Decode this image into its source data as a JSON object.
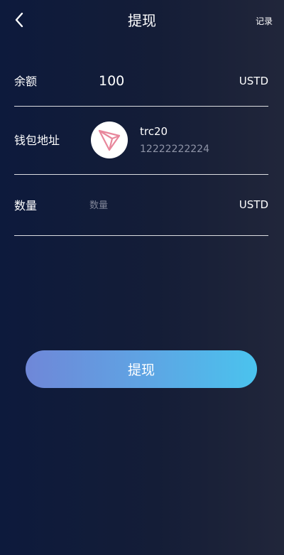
{
  "header": {
    "title": "提现",
    "records_label": "记录",
    "back_icon": "chevron-left-icon"
  },
  "balance": {
    "label": "余额",
    "value": "100",
    "unit": "USTD"
  },
  "wallet": {
    "label": "钱包地址",
    "network": "trc20",
    "address": "12222222224",
    "coin_icon": "tron-icon",
    "coin_color": "#e8879c"
  },
  "amount": {
    "label": "数量",
    "placeholder": "数量",
    "value": "",
    "unit": "USTD"
  },
  "submit": {
    "label": "提现"
  },
  "colors": {
    "button_start": "#6f87d8",
    "button_end": "#4ac3ee"
  }
}
